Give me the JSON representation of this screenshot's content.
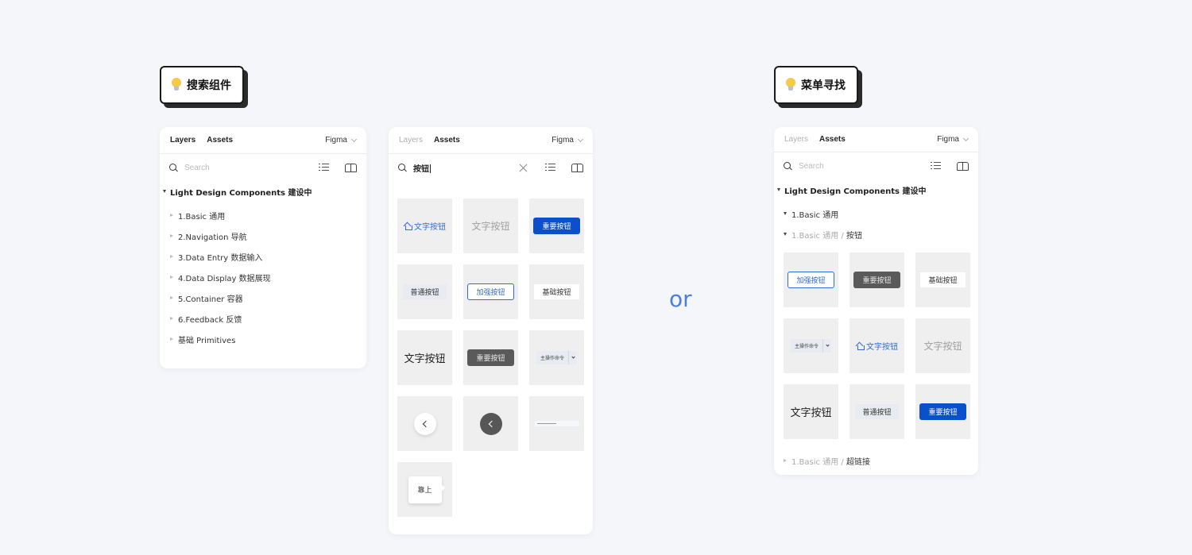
{
  "tags": {
    "left": {
      "icon": "lightbulb-icon",
      "label": "搜索组件"
    },
    "right": {
      "icon": "lightbulb-icon",
      "label": "菜单寻找"
    }
  },
  "separator": "or",
  "panel1": {
    "tabs": [
      "Layers",
      "Assets"
    ],
    "active_tab": "Layers",
    "library": "Figma",
    "search_placeholder": "Search",
    "root": "Light Design Components 建设中",
    "items": [
      "1.Basic 通用",
      "2.Navigation 导航",
      "3.Data Entry 数据输入",
      "4.Data Display 数据展现",
      "5.Container 容器",
      "6.Feedback 反馈",
      "基础 Primitives"
    ]
  },
  "panel2": {
    "tabs": [
      "Layers",
      "Assets"
    ],
    "active_tab": "Assets",
    "library": "Figma",
    "search_value": "按钮",
    "components": [
      {
        "type": "text-blue-icon",
        "label": "文字按钮",
        "icon": "home-icon"
      },
      {
        "type": "text-grey",
        "label": "文字按钮"
      },
      {
        "type": "primary",
        "label": "重要按钮"
      },
      {
        "type": "normal",
        "label": "普通按钮"
      },
      {
        "type": "outline",
        "label": "加强按钮"
      },
      {
        "type": "basic",
        "label": "基础按钮"
      },
      {
        "type": "text-dark",
        "label": "文字按钮"
      },
      {
        "type": "dark",
        "label": "重要按钮"
      },
      {
        "type": "split",
        "label": "主操作命令"
      },
      {
        "type": "circle-light",
        "icon": "chevron-left-icon"
      },
      {
        "type": "circle-dark",
        "icon": "chevron-left-icon"
      },
      {
        "type": "mini-bar",
        "label": ""
      },
      {
        "type": "tooltip",
        "label": "靠上"
      }
    ]
  },
  "panel3": {
    "tabs": [
      "Layers",
      "Assets"
    ],
    "active_tab": "Assets",
    "library": "Figma",
    "search_placeholder": "Search",
    "root": "Light Design Components 建设中",
    "section": "1.Basic 通用",
    "subsection": {
      "path": "1.Basic 通用",
      "sep": "/",
      "name": "按钮"
    },
    "components": [
      {
        "type": "outline",
        "label": "加强按钮"
      },
      {
        "type": "dark",
        "label": "重要按钮"
      },
      {
        "type": "basic",
        "label": "基础按钮"
      },
      {
        "type": "split",
        "label": "主操作命令"
      },
      {
        "type": "text-blue-icon",
        "label": "文字按钮",
        "icon": "home-icon"
      },
      {
        "type": "text-grey",
        "label": "文字按钮"
      },
      {
        "type": "text-dark",
        "label": "文字按钮"
      },
      {
        "type": "normal",
        "label": "普通按钮"
      },
      {
        "type": "primary",
        "label": "重要按钮"
      }
    ],
    "footer": {
      "path": "1.Basic 通用",
      "sep": "/",
      "name": "超链接"
    }
  },
  "colors": {
    "primary": "#0a4fcc",
    "accent": "#4a7fe0",
    "background": "#f5f6fa"
  }
}
